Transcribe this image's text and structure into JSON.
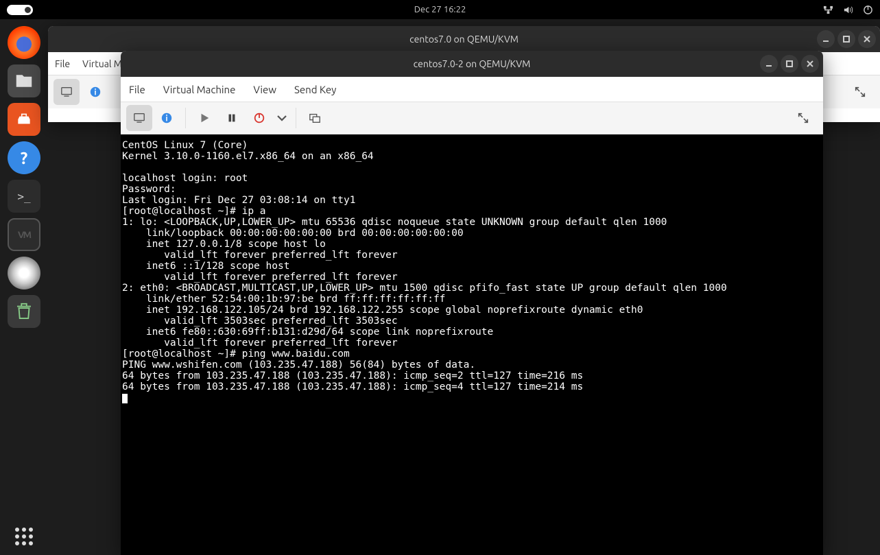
{
  "topbar": {
    "datetime": "Dec 27  16:22"
  },
  "dock_items": [
    "firefox",
    "files",
    "software",
    "help",
    "terminal",
    "virt-manager",
    "disc",
    "trash"
  ],
  "back_window": {
    "title": "centos7.0 on QEMU/KVM",
    "menu": [
      "File",
      "Virtual M"
    ]
  },
  "front_window": {
    "title": "centos7.0-2 on QEMU/KVM",
    "menu": [
      "File",
      "Virtual Machine",
      "View",
      "Send Key"
    ]
  },
  "terminal_lines": [
    "CentOS Linux 7 (Core)",
    "Kernel 3.10.0-1160.el7.x86_64 on an x86_64",
    "",
    "localhost login: root",
    "Password:",
    "Last login: Fri Dec 27 03:08:14 on tty1",
    "[root@localhost ~]# ip a",
    "1: lo: <LOOPBACK,UP,LOWER_UP> mtu 65536 qdisc noqueue state UNKNOWN group default qlen 1000",
    "    link/loopback 00:00:00:00:00:00 brd 00:00:00:00:00:00",
    "    inet 127.0.0.1/8 scope host lo",
    "       valid_lft forever preferred_lft forever",
    "    inet6 ::1/128 scope host",
    "       valid_lft forever preferred_lft forever",
    "2: eth0: <BROADCAST,MULTICAST,UP,LOWER_UP> mtu 1500 qdisc pfifo_fast state UP group default qlen 1000",
    "    link/ether 52:54:00:1b:97:be brd ff:ff:ff:ff:ff:ff",
    "    inet 192.168.122.105/24 brd 192.168.122.255 scope global noprefixroute dynamic eth0",
    "       valid_lft 3503sec preferred_lft 3503sec",
    "    inet6 fe80::630:69ff:b131:d29d/64 scope link noprefixroute",
    "       valid_lft forever preferred_lft forever",
    "[root@localhost ~]# ping www.baidu.com",
    "PING www.wshifen.com (103.235.47.188) 56(84) bytes of data.",
    "64 bytes from 103.235.47.188 (103.235.47.188): icmp_seq=2 ttl=127 time=216 ms",
    "64 bytes from 103.235.47.188 (103.235.47.188): icmp_seq=4 ttl=127 time=214 ms"
  ]
}
